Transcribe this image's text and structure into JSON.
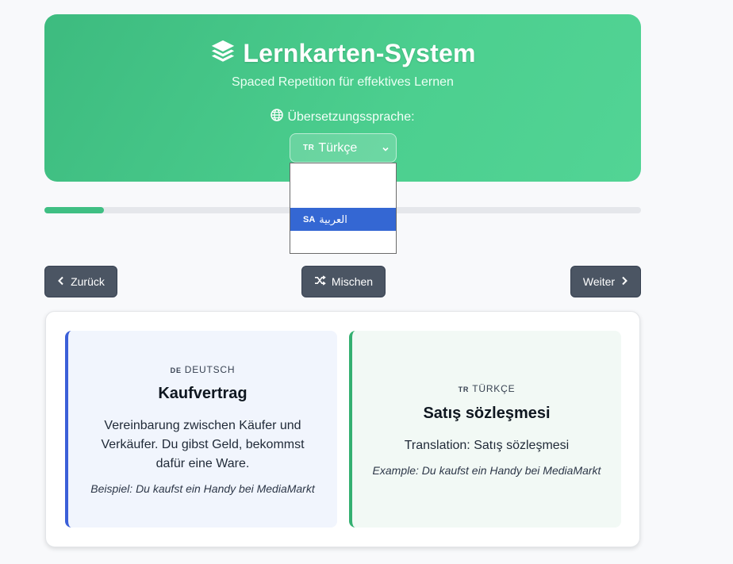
{
  "header": {
    "title": "Lernkarten-System",
    "subtitle": "Spaced Repetition für effektives Lernen",
    "language_label": "Übersetzungssprache:",
    "selected_language": {
      "code": "TR",
      "name": "Türkçe"
    }
  },
  "dropdown": {
    "options": [
      {
        "code": "",
        "name": ""
      },
      {
        "code": "",
        "name": ""
      },
      {
        "code": "SA",
        "name": "العربية",
        "selected": true
      },
      {
        "code": "",
        "name": ""
      }
    ]
  },
  "progress": {
    "fraction": 0.1
  },
  "nav": {
    "back_label": "Zurück",
    "shuffle_label": "Mischen",
    "next_label": "Weiter"
  },
  "card": {
    "source": {
      "code": "DE",
      "language": "DEUTSCH",
      "word": "Kaufvertrag",
      "definition": "Vereinbarung zwischen Käufer und Verkäufer. Du gibst Geld, bekommst dafür eine Ware.",
      "example": "Beispiel: Du kaufst ein Handy bei MediaMarkt"
    },
    "target": {
      "code": "TR",
      "language": "TÜRKÇE",
      "word": "Satış sözleşmesi",
      "translation": "Translation: Satış sözleşmesi",
      "example": "Example: Du kaufst ein Handy bei MediaMarkt"
    }
  },
  "colors": {
    "header_gradient_start": "#3dbb7f",
    "header_gradient_end": "#52d495",
    "button_bg": "#4b5563",
    "source_accent": "#3b5fd8",
    "target_accent": "#34b071",
    "progress_fill": "#3fbf83",
    "dropdown_selected": "#3467d3"
  },
  "icons": {
    "title_icon": "layers-icon",
    "language_icon": "globe-icon",
    "back_icon": "chevron-left-icon",
    "shuffle_icon": "shuffle-icon",
    "next_icon": "chevron-right-icon",
    "select_icon": "chevron-down-icon"
  }
}
